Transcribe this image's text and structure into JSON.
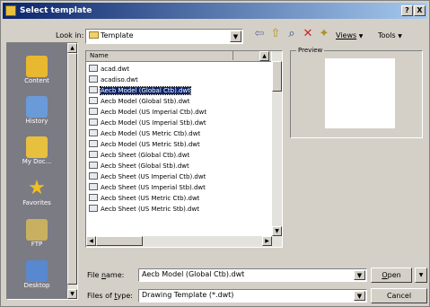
{
  "window": {
    "title": "Select template",
    "help_glyph": "?",
    "close_glyph": "X"
  },
  "toolbar": {
    "look_in_label": "Look in:",
    "look_in_value": "Template",
    "views_label": "Views",
    "tools_label": "Tools",
    "dropdown_glyph": "▼"
  },
  "places": [
    {
      "label": "Content",
      "icon": "content-folder-icon",
      "color": "#e8b830"
    },
    {
      "label": "History",
      "icon": "history-icon",
      "color": "#6a9ad8"
    },
    {
      "label": "My Doc...",
      "icon": "my-documents-icon",
      "color": "#e8c040"
    },
    {
      "label": "Favorites",
      "icon": "favorites-star-icon",
      "color": "#f0c020"
    },
    {
      "label": "FTP",
      "icon": "ftp-icon",
      "color": "#c8b060"
    },
    {
      "label": "Desktop",
      "icon": "desktop-icon",
      "color": "#5888d0"
    }
  ],
  "filelist": {
    "header_name": "Name",
    "files": [
      {
        "name": "acad.dwt",
        "selected": false
      },
      {
        "name": "acadiso.dwt",
        "selected": false
      },
      {
        "name": "Aecb Model (Global Ctb).dwt",
        "selected": true
      },
      {
        "name": "Aecb Model (Global Stb).dwt",
        "selected": false
      },
      {
        "name": "Aecb Model (US Imperial Ctb).dwt",
        "selected": false
      },
      {
        "name": "Aecb Model (US Imperial Stb).dwt",
        "selected": false
      },
      {
        "name": "Aecb Model (US Metric Ctb).dwt",
        "selected": false
      },
      {
        "name": "Aecb Model (US Metric Stb).dwt",
        "selected": false
      },
      {
        "name": "Aecb Sheet (Global Ctb).dwt",
        "selected": false
      },
      {
        "name": "Aecb Sheet (Global Stb).dwt",
        "selected": false
      },
      {
        "name": "Aecb Sheet (US Imperial Ctb).dwt",
        "selected": false
      },
      {
        "name": "Aecb Sheet (US Imperial Stb).dwt",
        "selected": false
      },
      {
        "name": "Aecb Sheet (US Metric Ctb).dwt",
        "selected": false
      },
      {
        "name": "Aecb Sheet (US Metric Stb).dwt",
        "selected": false
      }
    ]
  },
  "preview": {
    "label": "Preview"
  },
  "filename": {
    "label_prefix": "File ",
    "label_accel": "n",
    "label_suffix": "ame:",
    "value": "Aecb Model (Global Ctb).dwt"
  },
  "filetype": {
    "label_prefix": "Files of ",
    "label_accel": "t",
    "label_suffix": "ype:",
    "value": "Drawing Template (*.dwt)"
  },
  "buttons": {
    "open_accel": "O",
    "open_rest": "pen",
    "cancel": "Cancel"
  },
  "colors": {
    "title_start": "#0a246a",
    "title_end": "#a6caf0",
    "selection": "#0a246a",
    "places_bg": "#7b7b84"
  }
}
